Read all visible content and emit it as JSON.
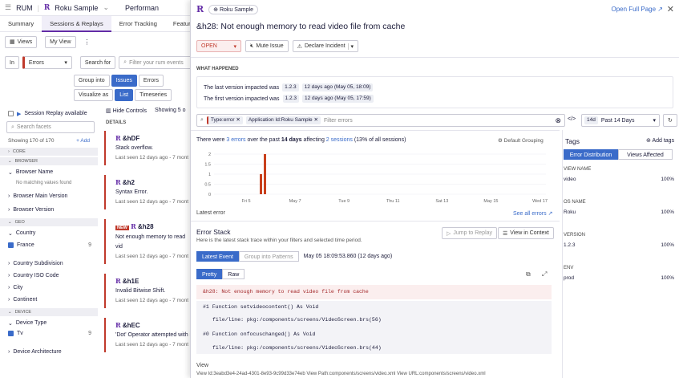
{
  "app": {
    "name": "RUM",
    "app_name": "Roku Sample",
    "perf_tab": "Performan"
  },
  "subtabs": [
    "Summary",
    "Sessions & Replays",
    "Error Tracking",
    "Feature Flag"
  ],
  "views_bar": {
    "views_label": "Views",
    "my_view": "My View"
  },
  "query": {
    "in_label": "In",
    "scope": "Errors",
    "search_for": "Search for",
    "placeholder": "Filter your rum events",
    "group_into": "Group into",
    "group_options": [
      "Issues",
      "Errors"
    ],
    "visualize_as": "Visualize as",
    "visualize_options": [
      "List",
      "Timeseries"
    ]
  },
  "sidebar": {
    "session_replay": "Session Replay available",
    "search_placeholder": "Search facets",
    "showing": "Showing 170 of 170",
    "add": "Add",
    "sections": [
      "CORE",
      "BROWSER"
    ],
    "browser_name": "Browser Name",
    "no_matching": "No matching values found",
    "browser_main_version": "Browser Main Version",
    "browser_version": "Browser Version",
    "geo": "GEO",
    "country": "Country",
    "france": "France",
    "france_count": "9",
    "country_subdivision": "Country Subdivision",
    "country_iso": "Country ISO Code",
    "city": "City",
    "continent": "Continent",
    "device": "DEVICE",
    "device_type": "Device Type",
    "tv": "Tv",
    "tv_count": "9",
    "device_arch": "Device Architecture"
  },
  "list": {
    "hide_controls": "Hide Controls",
    "showing": "Showing 5 o",
    "details": "DETAILS",
    "items": [
      {
        "id": "&hDF",
        "msg": "Stack overflow.",
        "seen": "Last seen 12 days ago - 7 mont",
        "new": ""
      },
      {
        "id": "&h2",
        "msg": "Syntax Error.",
        "seen": "Last seen 12 days ago - 7 mont",
        "new": ""
      },
      {
        "id": "&h28",
        "msg": "Not enough memory to read vid",
        "seen": "Last seen 12 days ago - 7 mont",
        "new": "NEW"
      },
      {
        "id": "&h1E",
        "msg": "Invalid Bitwise Shift.",
        "seen": "Last seen 12 days ago - 7 mont",
        "new": ""
      },
      {
        "id": "&hEC",
        "msg": "'Dot' Operator attempted with i",
        "seen": "Last seen 12 days ago - 7 mont",
        "new": ""
      }
    ]
  },
  "panel": {
    "app_chip": "Roku Sample",
    "open_full_page": "Open Full Page",
    "title": "&h28:  Not enough memory to read video file from cache",
    "status": "OPEN",
    "mute": "Mute Issue",
    "declare": "Declare Incident",
    "what_happened": "WHAT HAPPENED",
    "last_version_label": "The last version impacted was",
    "last_version": "1.2.3",
    "last_version_time": "12 days ago (May 05, 18:09)",
    "first_version_label": "The first version impacted was",
    "first_version": "1.2.3",
    "first_version_time": "12 days ago (May 05, 17:59)",
    "filters": [
      "Type:error",
      "Application Id:Roku Sample"
    ],
    "filter_placeholder": "Filter errors",
    "time_badge": "14d",
    "time_range": "Past 14 Days",
    "summary_pre": "There were",
    "summary_errors": "3 errors",
    "summary_mid": "over the past",
    "summary_days": "14 days",
    "summary_aff": "affecting",
    "summary_sessions": "2 sessions",
    "summary_post": "(13% of all sessions)",
    "default_grouping": "Default Grouping",
    "latest_error": "Latest error",
    "see_all": "See all errors",
    "error_stack": "Error Stack",
    "error_stack_sub": "Here is the latest stack trace within your filters and selected time period.",
    "jump_replay": "Jump to Replay",
    "view_context": "View in Context",
    "latest_event": "Latest Event",
    "group_patterns": "Group into Patterns",
    "event_time": "May 05 18:09:53.860 (12 days ago)",
    "pretty": "Pretty",
    "raw": "Raw",
    "stack_header": "&h28: Not enough memory to read video file from cache",
    "frames": [
      {
        "fn": "#1  Function setvideocontent() As Void",
        "file": "file/line: pkg:/components/screens/VideoScreen.brs(56)"
      },
      {
        "fn": "#0  Function onfocuschanged() As Void",
        "file": "file/line: pkg:/components/screens/VideoScreen.brs(44)"
      }
    ],
    "view_label": "View",
    "bottom_text": "View Id:3eabd3e4-24ad-4301-8e93-9c99d33e74eb    View Path:components/screens/video.xml    View URL:components/screens/video.xml"
  },
  "tags": {
    "title": "Tags",
    "add_tags": "Add tags",
    "tab_dist": "Error Distribution",
    "tab_views": "Views Affected",
    "groups": [
      {
        "name": "VIEW NAME",
        "value": "video",
        "pct": "100%"
      },
      {
        "name": "OS NAME",
        "value": "Roku",
        "pct": "100%"
      },
      {
        "name": "VERSION",
        "value": "1.2.3",
        "pct": "100%"
      },
      {
        "name": "ENV",
        "value": "prod",
        "pct": "100%"
      }
    ]
  },
  "chart_data": {
    "type": "bar",
    "y_ticks": [
      "2",
      "1.5",
      "1",
      "0.5",
      "0"
    ],
    "x_ticks": [
      "Fri 5",
      "May 7",
      "Tue 9",
      "Thu 11",
      "Sat 13",
      "May 15",
      "Wed 17"
    ],
    "ylim": [
      0,
      2
    ],
    "bars": [
      {
        "x": "May 5 (a)",
        "value": 1
      },
      {
        "x": "May 5 (b)",
        "value": 2
      }
    ]
  },
  "colors": {
    "accent": "#632ca6",
    "error": "#c9401c",
    "link": "#3a6bc9"
  }
}
